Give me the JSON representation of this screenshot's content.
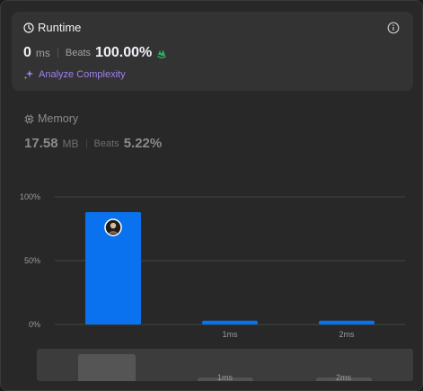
{
  "runtime": {
    "title": "Runtime",
    "value": "0",
    "unit": "ms",
    "beats_label": "Beats",
    "beats_value": "100.00%",
    "analyze_label": "Analyze Complexity"
  },
  "memory": {
    "title": "Memory",
    "value": "17.58",
    "unit": "MB",
    "beats_label": "Beats",
    "beats_value": "5.22%"
  },
  "colors": {
    "bar": "#0a72ef",
    "accent_purple": "#9f80ee",
    "clap_green": "#2db55d"
  },
  "chart_data": {
    "type": "bar",
    "categories": [
      "",
      "1ms",
      "2ms"
    ],
    "values": [
      88,
      3,
      3
    ],
    "ylim": [
      0,
      100
    ],
    "yticks": [
      "100%",
      "50%",
      "0%"
    ],
    "ytick_values": [
      100,
      50,
      0
    ],
    "grid": true,
    "highlight_index": 0
  },
  "minimap": {
    "labels": [
      "1ms",
      "2ms"
    ]
  }
}
